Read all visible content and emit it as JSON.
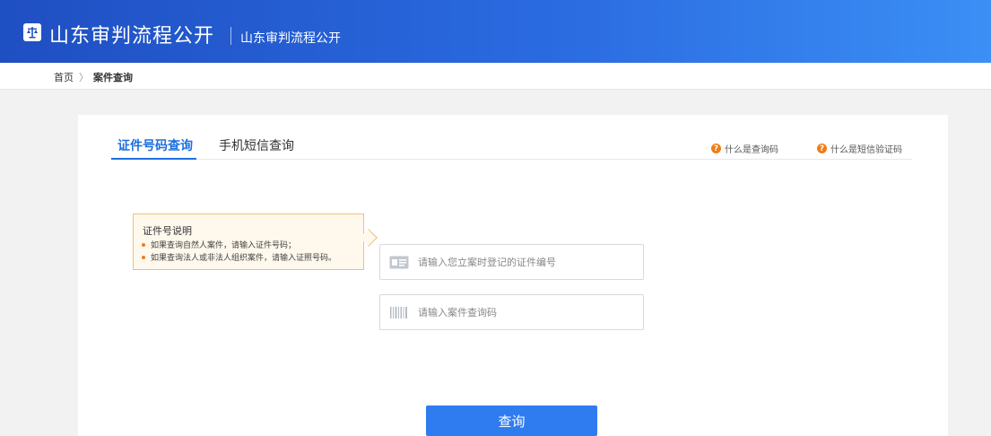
{
  "header": {
    "title": "山东审判流程公开",
    "subtitle": "山东审判流程公开",
    "logo_icon": "scales-icon"
  },
  "breadcrumb": {
    "home": "首页",
    "separator": "〉",
    "current": "案件查询"
  },
  "tabs": [
    {
      "label": "证件号码查询",
      "active": true
    },
    {
      "label": "手机短信查询",
      "active": false
    }
  ],
  "help_links": [
    {
      "label": "什么是查询码",
      "icon": "question-icon"
    },
    {
      "label": "什么是短信验证码",
      "icon": "question-icon"
    }
  ],
  "help_icon_glyph": "?",
  "tip": {
    "title": "证件号说明",
    "lines": [
      "如果查询自然人案件，请输入证件号码；",
      "如果查询法人或非法人组织案件，请输入证照号码。"
    ]
  },
  "form": {
    "cert_placeholder": "请输入您立案时登记的证件编号",
    "cert_value": "",
    "code_placeholder": "请输入案件查询码",
    "code_value": "",
    "submit_label": "查询"
  },
  "colors": {
    "accent": "#1d6fe0",
    "header_start": "#1f4fc2",
    "header_end": "#3b8ff5",
    "help_icon": "#f07d18",
    "tip_border": "#f5bd77"
  }
}
